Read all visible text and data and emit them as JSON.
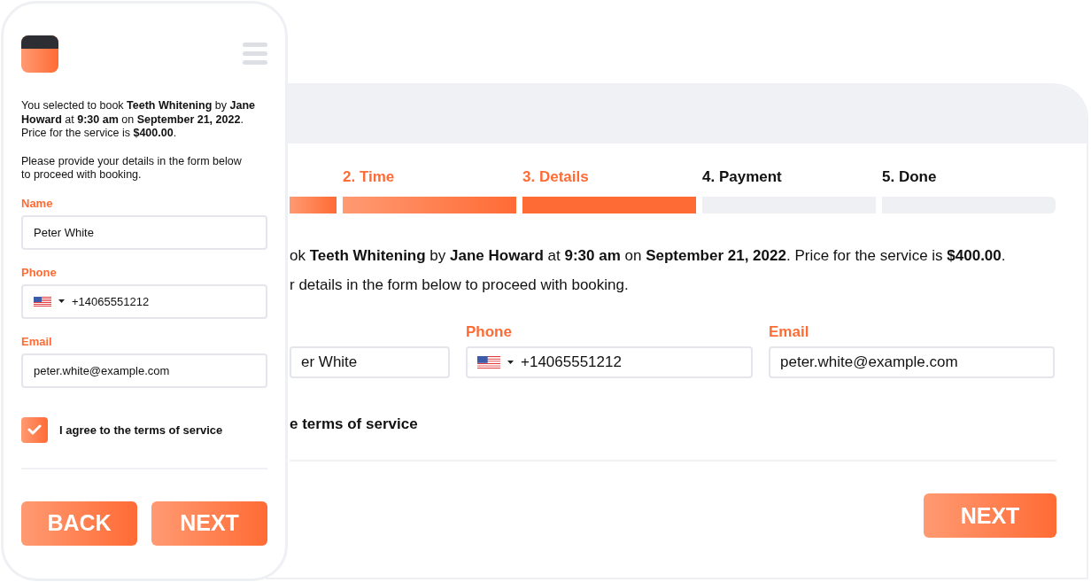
{
  "desktop": {
    "steps": [
      {
        "completed": true,
        "selected": false
      },
      {
        "label": "2. Time",
        "completed": true,
        "selected": false
      },
      {
        "label": "3. Details",
        "completed": false,
        "selected": true
      },
      {
        "label": "4. Payment",
        "completed": false,
        "selected": false
      },
      {
        "label": "5. Done",
        "completed": false,
        "selected": false
      }
    ],
    "summary": "ok **Teeth Whitening** by **Jane Howard** at **9:30 am** on **September 21, 2022**. Price for the service is **$400.00**.",
    "instruction": "r details in the form below to proceed with booking.",
    "fields": [
      {
        "kind": "text",
        "value": "er White"
      },
      {
        "kind": "phone",
        "label": "Phone",
        "value": "+14065551212"
      },
      {
        "kind": "text",
        "label": "Email",
        "value": "peter.white@example.com"
      }
    ],
    "agree_label": "e terms of service",
    "buttons": [
      "NEXT"
    ]
  },
  "phone": {
    "summary": "You selected to book **Teeth Whitening** by **Jane Howard** at **9:30 am** on **September 21, 2022**. Price for the service is **$400.00**.",
    "instruction": "Please provide your details in the form below to proceed with booking.",
    "fields": [
      {
        "kind": "text",
        "label": "Name",
        "value": "Peter White"
      },
      {
        "kind": "phone",
        "label": "Phone",
        "value": "+14065551212"
      },
      {
        "kind": "text",
        "label": "Email",
        "value": "peter.white@example.com"
      }
    ],
    "agree": {
      "label": "I agree to the terms of service",
      "checked": true
    },
    "buttons": [
      "BACK",
      "NEXT"
    ]
  }
}
